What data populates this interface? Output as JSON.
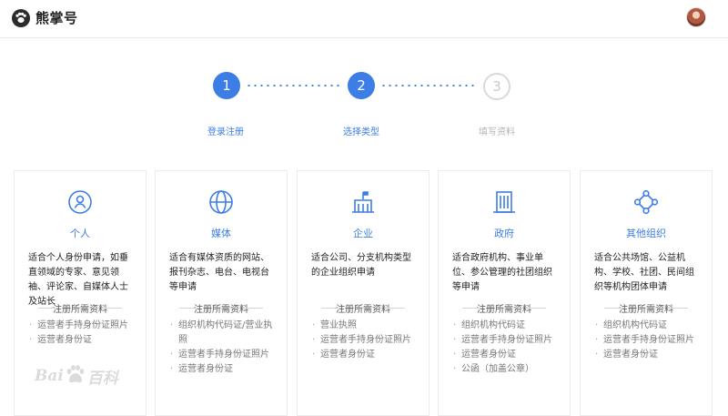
{
  "header": {
    "brand": "熊掌号",
    "logo_icon": "paw-icon",
    "avatar_icon": "user-avatar"
  },
  "steps": [
    {
      "number": "1",
      "label": "登录注册",
      "state": "done"
    },
    {
      "number": "2",
      "label": "选择类型",
      "state": "current"
    },
    {
      "number": "3",
      "label": "填写资料",
      "state": "pending"
    }
  ],
  "colors": {
    "accent": "#3c7de6",
    "muted": "#b5b5b5"
  },
  "cards": [
    {
      "icon": "person-icon",
      "title": "个人",
      "desc": "适合个人身份申请，如垂直领域的专家、意见领袖、评论家、自媒体人士及站长",
      "req_title": "注册所需资料",
      "requirements": [
        "运营者手持身份证照片",
        "运营者身份证"
      ]
    },
    {
      "icon": "globe-icon",
      "title": "媒体",
      "desc": "适合有媒体资质的网站、报刊杂志、电台、电视台等申请",
      "req_title": "注册所需资料",
      "requirements": [
        "组织机构代码证/营业执照",
        "运营者手持身份证照片",
        "运营者身份证"
      ]
    },
    {
      "icon": "building-flag-icon",
      "title": "企业",
      "desc": "适合公司、分支机构类型的企业组织申请",
      "req_title": "注册所需资料",
      "requirements": [
        "营业执照",
        "运营者手持身份证照片",
        "运营者身份证"
      ]
    },
    {
      "icon": "government-building-icon",
      "title": "政府",
      "desc": "适合政府机构、事业单位、参公管理的社团组织等申请",
      "req_title": "注册所需资料",
      "requirements": [
        "组织机构代码证",
        "运营者手持身份证照片",
        "运营者身份证",
        "公函（加盖公章）"
      ]
    },
    {
      "icon": "network-icon",
      "title": "其他组织",
      "desc": "适合公共场馆、公益机构、学校、社团、民间组织等机构团体申请",
      "req_title": "注册所需资料",
      "requirements": [
        "组织机构代码证",
        "运营者手持身份证照片",
        "运营者身份证"
      ]
    }
  ],
  "watermark": {
    "left": "Bai",
    "right": "百科"
  }
}
